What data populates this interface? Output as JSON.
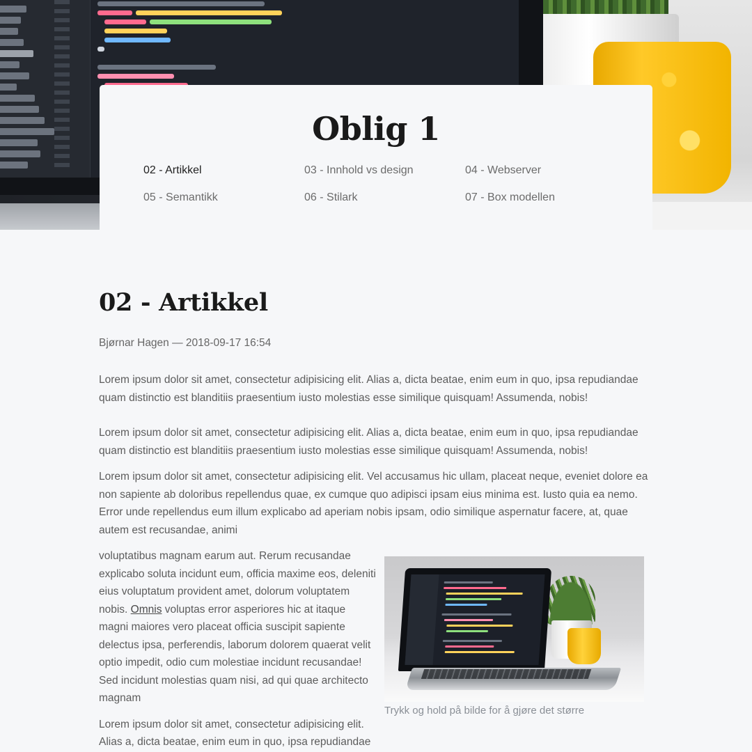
{
  "header": {
    "title": "Oblig 1",
    "nav": [
      {
        "label": "02 - Artikkel",
        "active": true
      },
      {
        "label": "03 - Innhold vs design",
        "active": false
      },
      {
        "label": "04 - Webserver",
        "active": false
      },
      {
        "label": "05 - Semantikk",
        "active": false
      },
      {
        "label": "06 - Stilark",
        "active": false
      },
      {
        "label": "07 - Box modellen",
        "active": false
      }
    ]
  },
  "article": {
    "title": "02 - Artikkel",
    "meta": "Bjørnar Hagen — 2018-09-17 16:54",
    "paragraphs": [
      "Lorem ipsum dolor sit amet, consectetur adipisicing elit. Alias a, dicta beatae, enim eum in quo, ipsa repudiandae quam distinctio est blanditiis praesentium iusto molestias esse similique quisquam! Assumenda, nobis!",
      "Lorem ipsum dolor sit amet, consectetur adipisicing elit. Alias a, dicta beatae, enim eum in quo, ipsa repudiandae quam distinctio est blanditiis praesentium iusto molestias esse similique quisquam! Assumenda, nobis!",
      "Lorem ipsum dolor sit amet, consectetur adipisicing elit. Vel accusamus hic ullam, placeat neque, eveniet dolore ea non sapiente ab doloribus repellendus quae, ex cumque quo adipisci ipsam eius minima est. Iusto quia ea nemo. Error unde repellendus eum illum explicabo ad aperiam nobis ipsam, odio similique aspernatur facere, at, quae autem est recusandae, animi"
    ],
    "float_paragraph": {
      "before_link": "voluptatibus magnam earum aut. Rerum recusandae explicabo soluta incidunt eum, officia maxime eos, deleniti eius voluptatum provident amet, dolorum voluptatem nobis. ",
      "link": "Omnis",
      "after_link": " voluptas error asperiores hic at itaque magni maiores vero placeat officia suscipit sapiente delectus ipsa, perferendis, laborum dolorem quaerat velit optio impedit, odio cum molestiae incidunt recusandae! Sed incidunt molestias quam nisi, ad qui quae architecto magnam"
    },
    "last_paragraph": "Lorem ipsum dolor sit amet, consectetur adipisicing elit. Alias a, dicta beatae, enim eum in quo, ipsa repudiandae",
    "figure": {
      "caption": "Trykk og hold på bilde for å gjøre det større",
      "image_name": "laptop-with-code-photo"
    }
  },
  "colors": {
    "background": "#f6f7f9",
    "heading": "#1a1a1a",
    "body_text": "#5c5c5c",
    "caption": "#8a8f96",
    "accent_yellow": "#ffc928"
  }
}
